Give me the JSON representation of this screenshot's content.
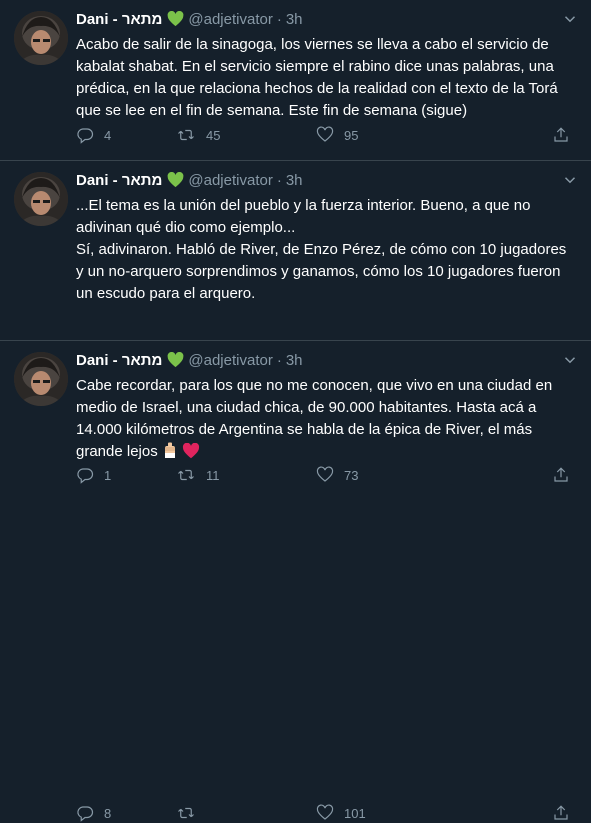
{
  "colors": {
    "background": "#15202b",
    "text": "#ffffff",
    "secondary": "#8899a6",
    "divider": "#38444d",
    "green_heart": "#7bc24a",
    "red_heart": "#e0245e"
  },
  "tweets": [
    {
      "author": {
        "name": "Dani - מתאר",
        "badge": "green-heart-icon",
        "handle": "@adjetivator"
      },
      "dot": "·",
      "time": "3h",
      "text": "Acabo de salir de la sinagoga, los viernes se lleva a cabo el servicio de kabalat shabat. En el servicio siempre el rabino dice unas palabras, una prédica, en la que relaciona hechos de la realidad con el texto de la Torá que se lee en el fin de semana. Este fin de semana (sigue)",
      "replies": "4",
      "retweets": "45",
      "likes": "95"
    },
    {
      "author": {
        "name": "Dani - מתאר",
        "badge": "green-heart-icon",
        "handle": "@adjetivator"
      },
      "dot": "·",
      "time": "3h",
      "text": "...El tema es la unión del pueblo y la fuerza interior. Bueno, a que no adivinan qué dio como ejemplo...\nSí, adivinaron. Habló de River, de Enzo Pérez, de cómo con 10 jugadores y un no-arquero sorprendimos y ganamos, cómo los 10 jugadores fueron un escudo para el arquero.",
      "replies": "1",
      "retweets": "11",
      "likes": "73"
    },
    {
      "author": {
        "name": "Dani - מתאר",
        "badge": "green-heart-icon",
        "handle": "@adjetivator"
      },
      "dot": "·",
      "time": "3h",
      "text": "Cabe recordar, para los que no me conocen, que vivo en una ciudad en medio de Israel, una ciudad chica, de 90.000 habitantes. Hasta acá a 14.000 kilómetros de Argentina se habla de la épica de River, el más grande lejos",
      "trailing_emojis": [
        "fist-emoji",
        "red-heart-emoji"
      ],
      "replies": "8",
      "retweets": "",
      "likes": "101"
    }
  ]
}
